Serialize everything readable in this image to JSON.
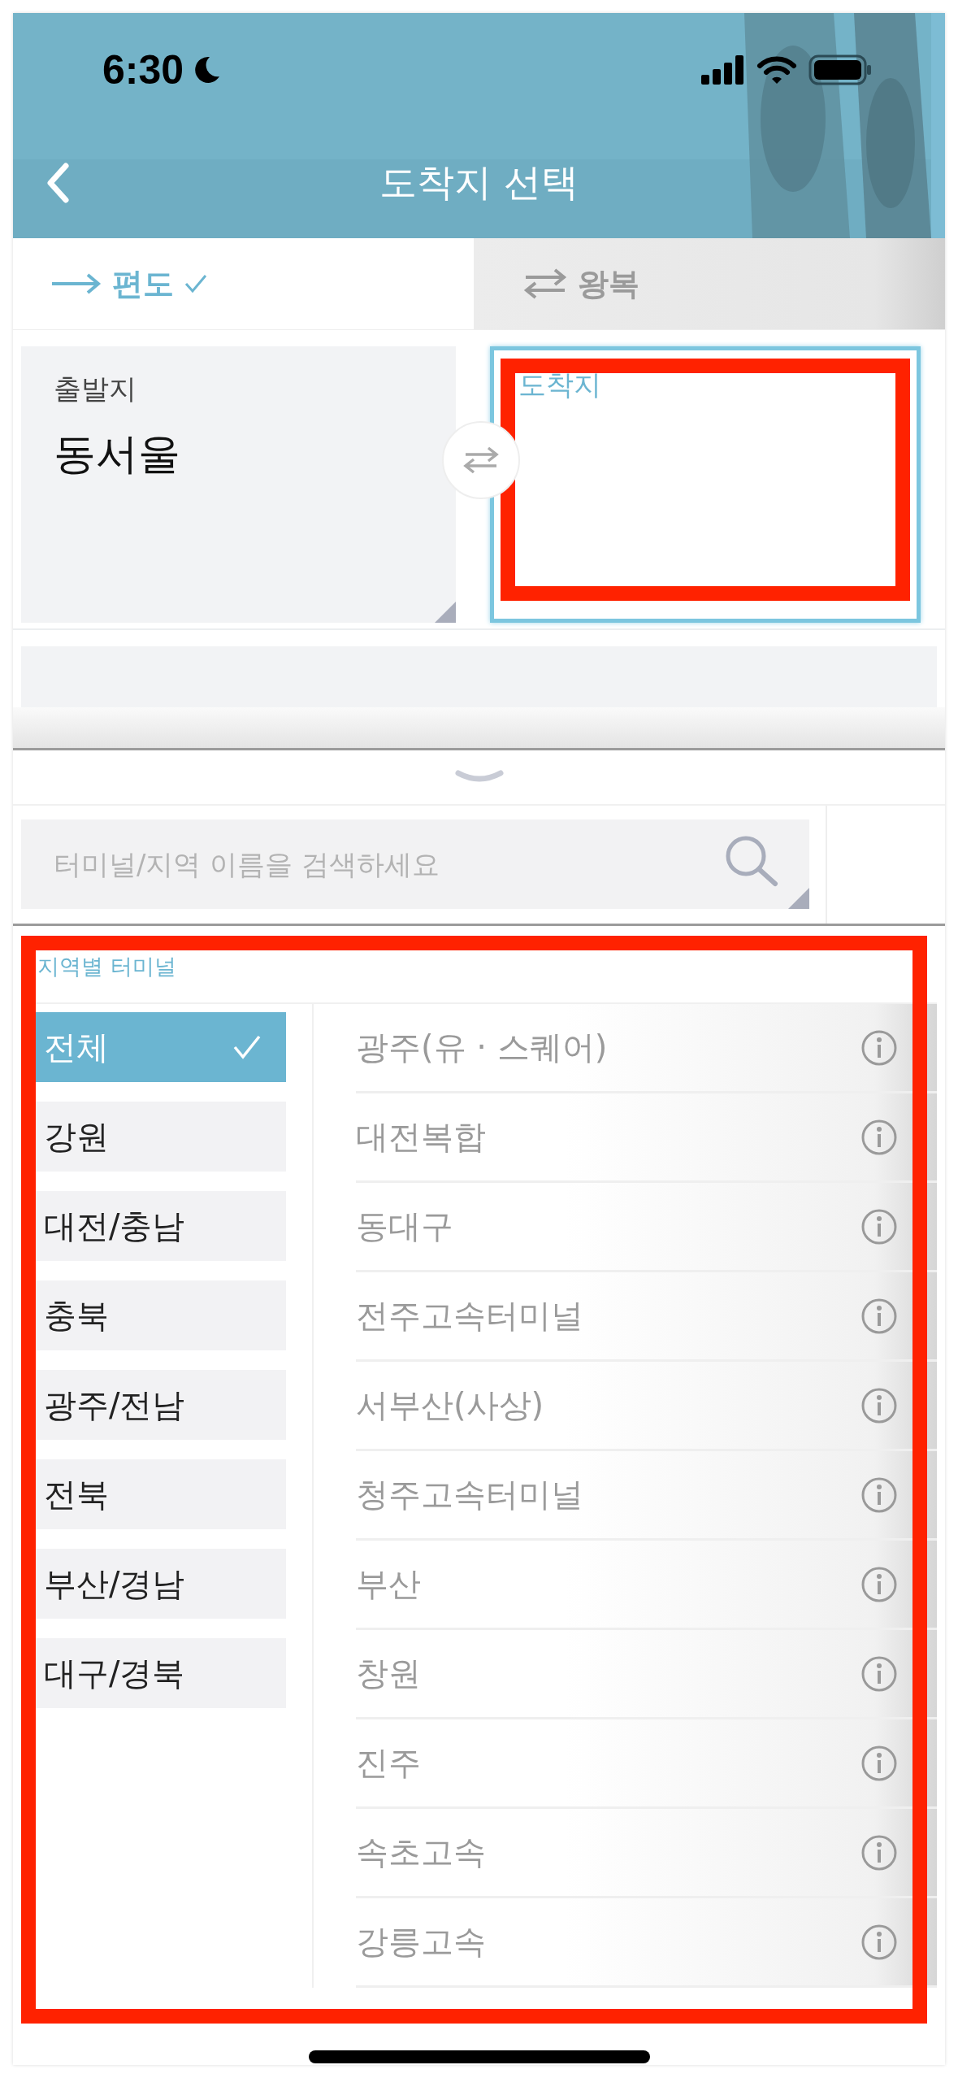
{
  "status_bar": {
    "time": "6:30"
  },
  "header": {
    "title": "도착지 선택"
  },
  "trip_tabs": [
    {
      "kind": "one-way",
      "label": "편도",
      "selected": true
    },
    {
      "kind": "round-trip",
      "label": "왕복",
      "selected": false
    }
  ],
  "departure": {
    "label": "출발지",
    "value": "동서울"
  },
  "arrival": {
    "label": "도착지",
    "focused": true,
    "highlighted": true
  },
  "search": {
    "placeholder": "터미널/지역 이름을 검색하세요"
  },
  "terminals": {
    "title": "지역별 터미널",
    "highlighted": true,
    "regions": [
      {
        "label": "전체",
        "selected": true
      },
      {
        "label": "강원",
        "selected": false
      },
      {
        "label": "대전/충남",
        "selected": false
      },
      {
        "label": "충북",
        "selected": false
      },
      {
        "label": "광주/전남",
        "selected": false
      },
      {
        "label": "전북",
        "selected": false
      },
      {
        "label": "부산/경남",
        "selected": false
      },
      {
        "label": "대구/경북",
        "selected": false
      }
    ],
    "items": [
      {
        "name": "광주(유 · 스퀘어)"
      },
      {
        "name": "대전복합"
      },
      {
        "name": "동대구"
      },
      {
        "name": "전주고속터미널"
      },
      {
        "name": "서부산(사상)"
      },
      {
        "name": "청주고속터미널"
      },
      {
        "name": "부산"
      },
      {
        "name": "창원"
      },
      {
        "name": "진주"
      },
      {
        "name": "속초고속"
      },
      {
        "name": "강릉고속"
      }
    ]
  }
}
